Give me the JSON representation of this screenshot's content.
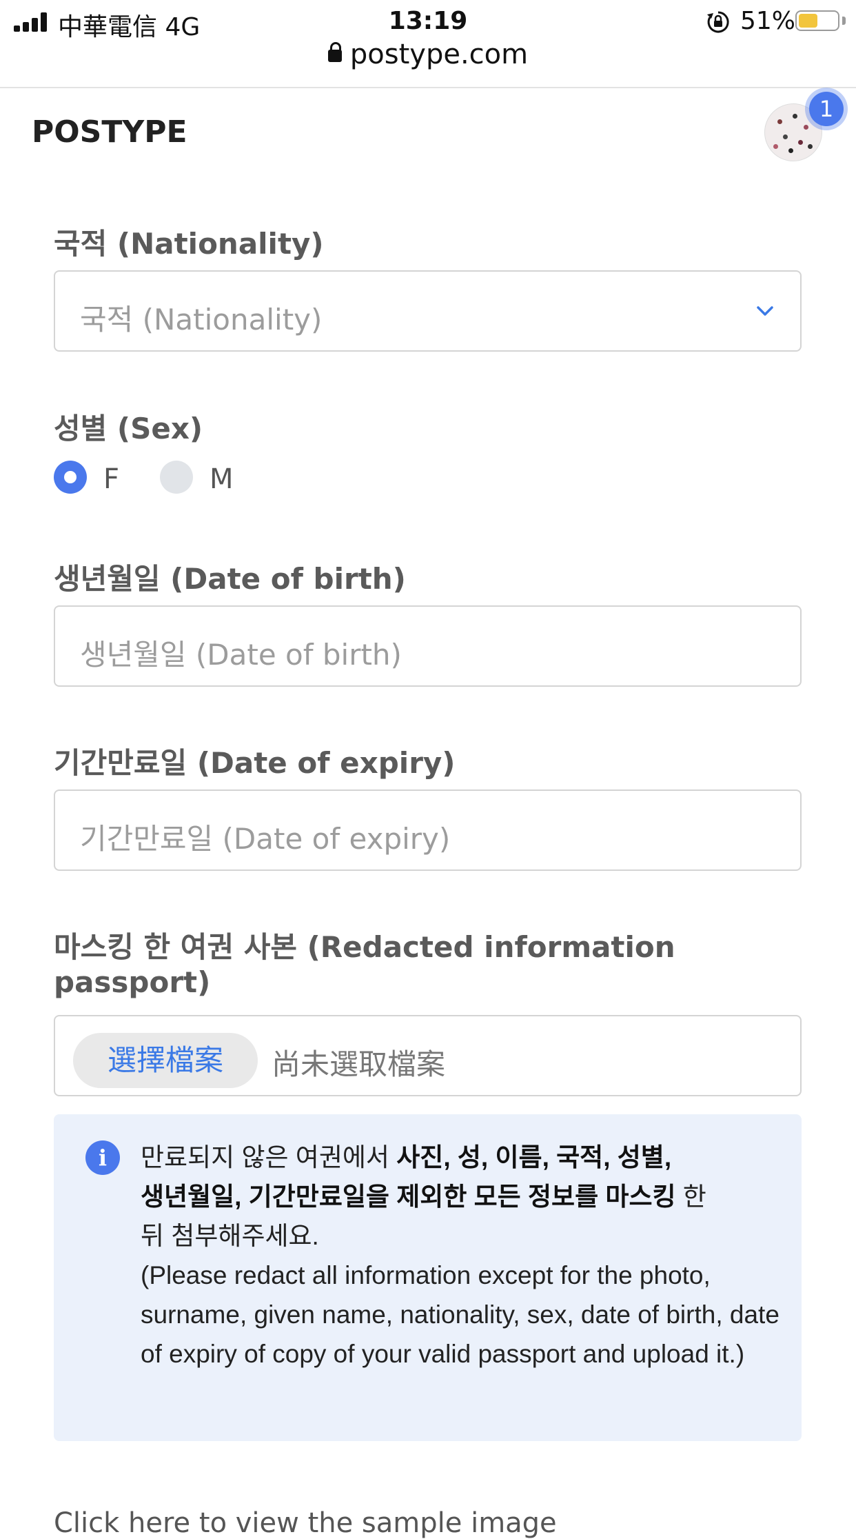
{
  "status_bar": {
    "carrier": "中華電信   4G",
    "time": "13:19",
    "battery_percent": "51%",
    "battery_level": 0.51
  },
  "browser": {
    "url": "postype.com"
  },
  "header": {
    "logo": "POSTYPE",
    "notification_count": "1"
  },
  "form": {
    "nationality": {
      "label": "국적 (Nationality)",
      "placeholder": "국적 (Nationality)"
    },
    "sex": {
      "label": "성별 (Sex)",
      "options": [
        "F",
        "M"
      ],
      "selected": "F"
    },
    "date_of_birth": {
      "label": "생년월일 (Date of birth)",
      "placeholder": "생년월일 (Date of birth)"
    },
    "date_of_expiry": {
      "label": "기간만료일 (Date of expiry)",
      "placeholder": "기간만료일 (Date of expiry)"
    },
    "passport_copy": {
      "label_line1": "마스킹 한 여권 사본 (Redacted information",
      "label_line2": "passport)",
      "choose_file_button": "選擇檔案",
      "file_status": "尚未選取檔案"
    }
  },
  "info": {
    "line1_normal": "만료되지 않은 여권에서 ",
    "line1_bold": "사진, 성, 이름, 국적, 성별,",
    "line2_bold": "생년월일, 기간만료일을 제외한 모든 정보를 마스킹",
    "line2_normal": " 한",
    "line3": "뒤 첨부해주세요.",
    "english": "(Please redact all information except for the photo, surname, given name, nationality, sex, date of birth, date of expiry of copy of your valid passport and upload it.)"
  },
  "sample_link": "Click here to view the sample image",
  "colors": {
    "accent": "#4a78ec",
    "link": "#3a79e6",
    "info_bg": "#ebf1fb",
    "battery": "#f2c53d"
  },
  "icons": [
    "signal-icon",
    "rotation-lock-icon",
    "battery-icon",
    "padlock-icon",
    "chevron-down-icon",
    "info-icon"
  ]
}
